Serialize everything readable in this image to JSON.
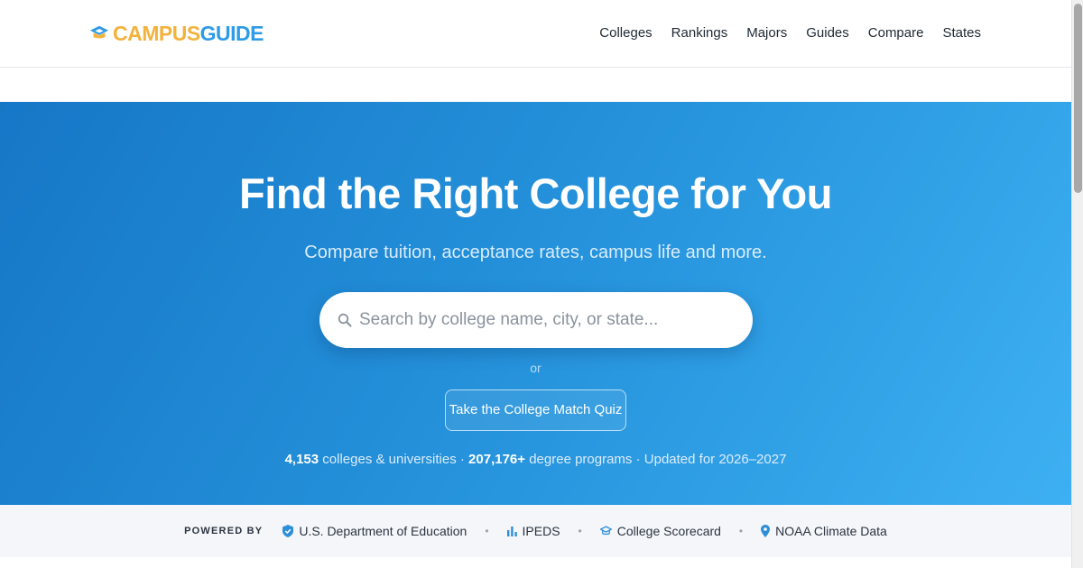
{
  "brand": {
    "name_part1": "CAMPUS",
    "name_part2": "GUIDE",
    "icon": "graduation-cap-icon",
    "color_primary": "#f3b23c",
    "color_secondary": "#2e9be6"
  },
  "nav": {
    "items": [
      {
        "label": "Colleges"
      },
      {
        "label": "Rankings"
      },
      {
        "label": "Majors"
      },
      {
        "label": "Guides"
      },
      {
        "label": "Compare"
      },
      {
        "label": "States"
      }
    ]
  },
  "hero": {
    "title": "Find the Right College for You",
    "subtitle": "Compare tuition, acceptance rates, campus life and more.",
    "search_placeholder": "Search by college name, city, or state...",
    "search_icon": "search-icon",
    "or_label": "or",
    "quiz_button": "Take the College Match Quiz",
    "gradient_start": "#1677c7",
    "gradient_end": "#3db0f2"
  },
  "stats": {
    "colleges_count": "4,153",
    "colleges_label": "colleges & universities",
    "separator": "·",
    "programs_count": "207,176+",
    "programs_label": "degree programs",
    "updated_label": "Updated for 2026–2027"
  },
  "powered_by": {
    "label": "POWERED BY",
    "sources": [
      {
        "name": "U.S. Department of Education",
        "icon": "shield-check-icon"
      },
      {
        "name": "IPEDS",
        "icon": "bar-chart-icon"
      },
      {
        "name": "College Scorecard",
        "icon": "graduation-cap-icon"
      },
      {
        "name": "NOAA Climate Data",
        "icon": "map-pin-icon"
      }
    ],
    "separator": "•"
  }
}
